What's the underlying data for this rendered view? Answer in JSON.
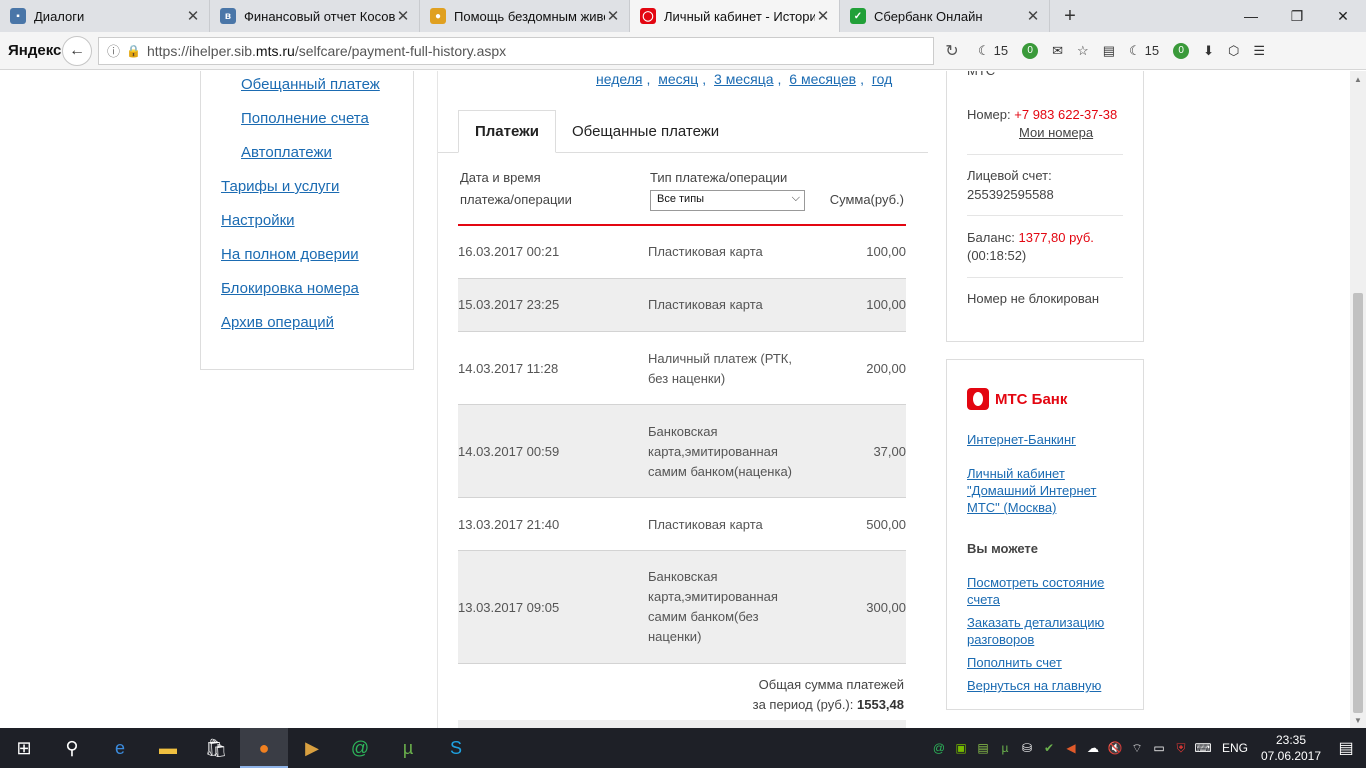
{
  "browser": {
    "tabs": [
      {
        "title": "Диалоги",
        "favicon_color": "#4a76a8"
      },
      {
        "title": "Финансовый отчет Косово",
        "favicon_color": "#4a76a8"
      },
      {
        "title": "Помощь бездомным живо",
        "favicon_color": "#e0a020"
      },
      {
        "title": "Личный кабинет - История",
        "favicon_color": "#e30611"
      },
      {
        "title": "Сбербанк Онлайн",
        "favicon_color": "#21a038"
      }
    ],
    "active_tab": 3,
    "new_tab": "+",
    "brand": "Яндекс",
    "url_prefix": "https://ihelper.sib.",
    "url_host": "mts.ru",
    "url_path": "/selfcare/payment-full-history.aspx",
    "weather_temp_1": "15",
    "badge_1": "0",
    "weather_temp_2": "15",
    "badge_2": "0"
  },
  "left_menu": {
    "items": [
      {
        "label": "Обещанный платеж",
        "indent": true
      },
      {
        "label": "Пополнение счета",
        "indent": true
      },
      {
        "label": "Автоплатежи",
        "indent": true
      },
      {
        "label": "Тарифы и услуги",
        "indent": false
      },
      {
        "label": "Настройки",
        "indent": false
      },
      {
        "label": "На полном доверии",
        "indent": false
      },
      {
        "label": "Блокировка номера",
        "indent": false
      },
      {
        "label": "Архив операций",
        "indent": false
      }
    ]
  },
  "periods": [
    "неделя",
    "месяц",
    "3 месяца",
    "6 месяцев",
    "год"
  ],
  "tabs": {
    "payments": "Платежи",
    "promised": "Обещанные платежи"
  },
  "table": {
    "col_date_line1": "Дата и время",
    "col_date_line2": "платежа/операции",
    "col_type": "Тип платежа/операции",
    "col_sum": "Сумма(руб.)",
    "filter_value": "Все типы",
    "rows": [
      {
        "date": "16.03.2017 00:21",
        "type": "Пластиковая карта",
        "sum": "100,00"
      },
      {
        "date": "15.03.2017 23:25",
        "type": "Пластиковая карта",
        "sum": "100,00"
      },
      {
        "date": "14.03.2017 11:28",
        "type": "Наличный платеж (РТК, без наценки)",
        "sum": "200,00"
      },
      {
        "date": "14.03.2017 00:59",
        "type": "Банковская карта,эмитированная самим банком(наценка)",
        "sum": "37,00"
      },
      {
        "date": "13.03.2017 21:40",
        "type": "Пластиковая карта",
        "sum": "500,00"
      },
      {
        "date": "13.03.2017 09:05",
        "type": "Банковская карта,эмитированная самим банком(без наценки)",
        "sum": "300,00"
      }
    ],
    "total_line1": "Общая сумма платежей",
    "total_line2": "за период (руб.):",
    "total_value": "1553,48"
  },
  "account": {
    "brand_text": "МТС",
    "number_label": "Номер:",
    "number_value": "+7 983 622-37-38",
    "my_numbers": "Мои номера",
    "account_label": "Лицевой счет:",
    "account_value": "255392595588",
    "balance_label": "Баланс:",
    "balance_value": "1377,80 руб.",
    "balance_time": "(00:18:52)",
    "status": "Номер не блокирован"
  },
  "bank": {
    "logo": "МТС Банк",
    "internet_banking": "Интернет-Банкинг",
    "home_internet": "Личный кабинет \"Домашний Интернет МТС\" (Москва)",
    "you_can": "Вы можете",
    "actions": [
      "Посмотреть состояние счета",
      "Заказать детализацию разговоров",
      "Пополнить счет",
      "Вернуться на главную"
    ]
  },
  "taskbar": {
    "lang": "ENG",
    "time": "23:35",
    "date": "07.06.2017"
  }
}
